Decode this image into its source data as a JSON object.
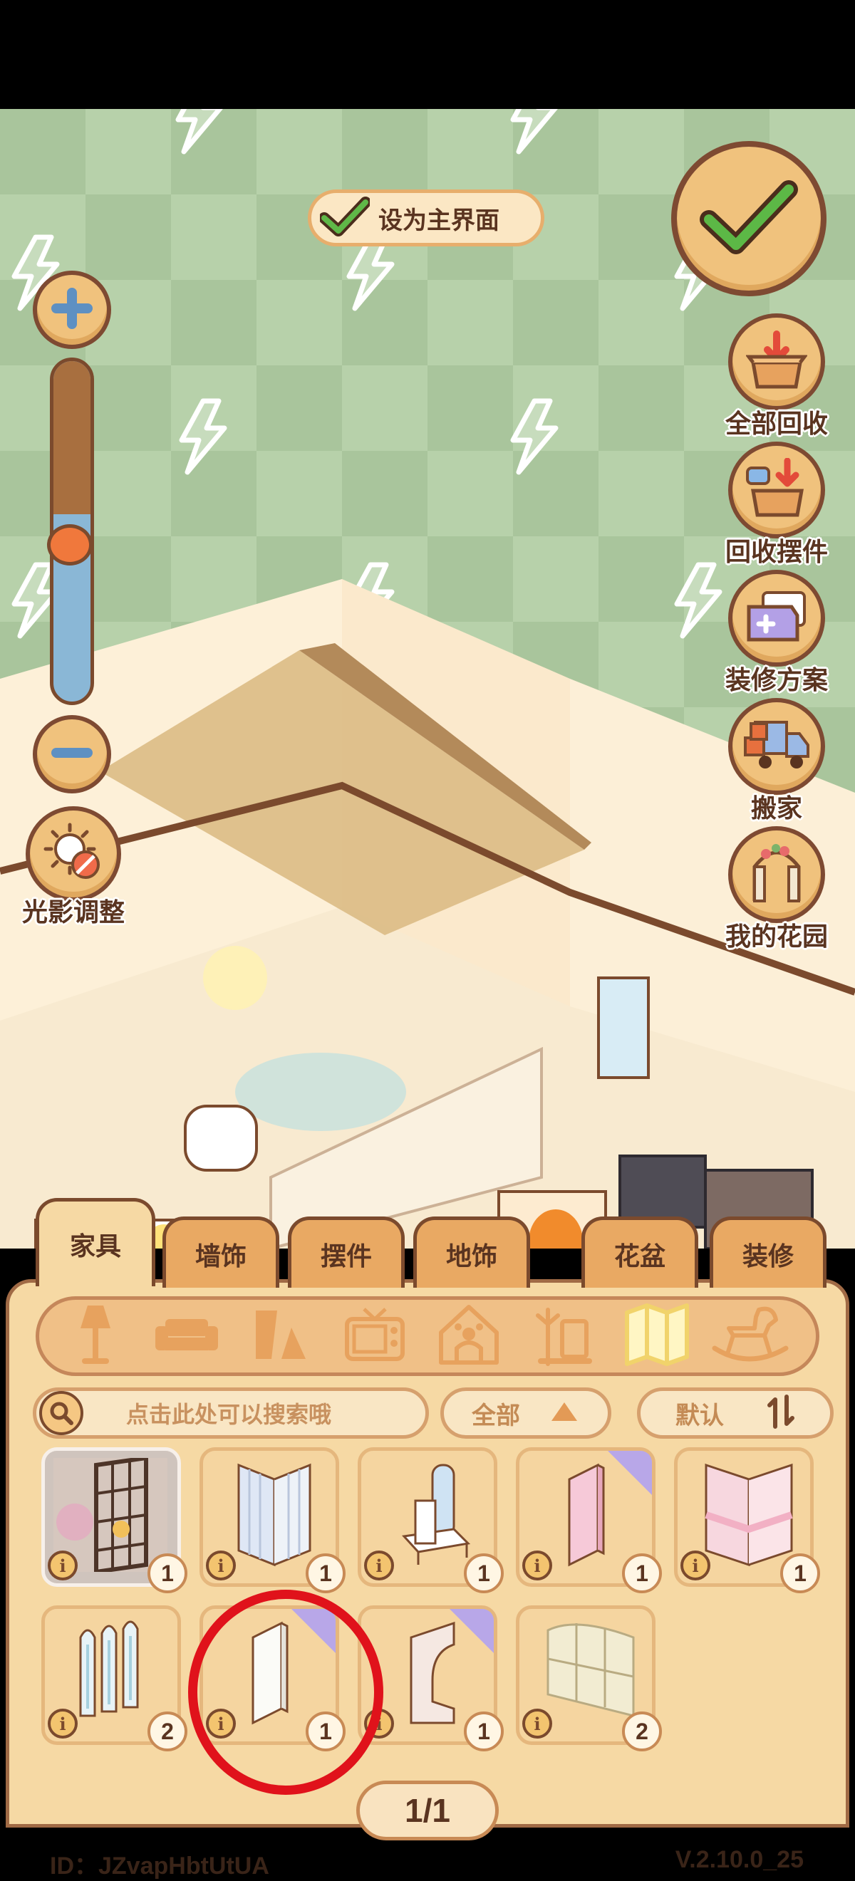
{
  "top": {
    "set_home_label": "设为主界面"
  },
  "zoom": {
    "level": 0.45
  },
  "side_buttons": [
    {
      "label": "全部回收",
      "icon": "recycle-all-icon"
    },
    {
      "label": "回收摆件",
      "icon": "recycle-decor-icon"
    },
    {
      "label": "装修方案",
      "icon": "renovation-plan-icon"
    },
    {
      "label": "搬家",
      "icon": "moving-truck-icon"
    },
    {
      "label": "我的花园",
      "icon": "garden-arch-icon"
    }
  ],
  "light_adjust_label": "光影调整",
  "tabs": [
    "家具",
    "墙饰",
    "摆件",
    "地饰",
    "花盆",
    "装修"
  ],
  "categories": [
    "lamp-icon",
    "sofa-icon",
    "shelf-icon",
    "tv-icon",
    "pet-house-icon",
    "coat-rack-icon",
    "folding-screen-icon",
    "rocking-horse-icon"
  ],
  "search": {
    "placeholder": "点击此处可以搜索哦"
  },
  "filter": {
    "label": "全部"
  },
  "sort": {
    "label": "默认"
  },
  "items": [
    {
      "count": "1",
      "name": "shelf-grid-item",
      "badge": false
    },
    {
      "count": "1",
      "name": "curtain-panel-item",
      "badge": false
    },
    {
      "count": "1",
      "name": "dressing-table-item",
      "badge": false
    },
    {
      "count": "1",
      "name": "pink-wall-panel-item",
      "badge": true
    },
    {
      "count": "1",
      "name": "pink-curtain-item",
      "badge": false
    },
    {
      "count": "2",
      "name": "glass-screen-item",
      "badge": false
    },
    {
      "count": "1",
      "name": "white-wall-panel-item",
      "badge": true
    },
    {
      "count": "1",
      "name": "arch-wall-item",
      "badge": true
    },
    {
      "count": "2",
      "name": "window-grid-item",
      "badge": false
    }
  ],
  "page_indicator": "1/1",
  "footer": {
    "id_text": "ID：JZvapHbtUtUA",
    "version": "V.2.10.0_25"
  },
  "colors": {
    "brown": "#7b4a2d",
    "orange": "#f0c27d",
    "green_check": "#4ca64c",
    "panel": "#f6d9a4",
    "highlight_red": "#e0121b"
  }
}
